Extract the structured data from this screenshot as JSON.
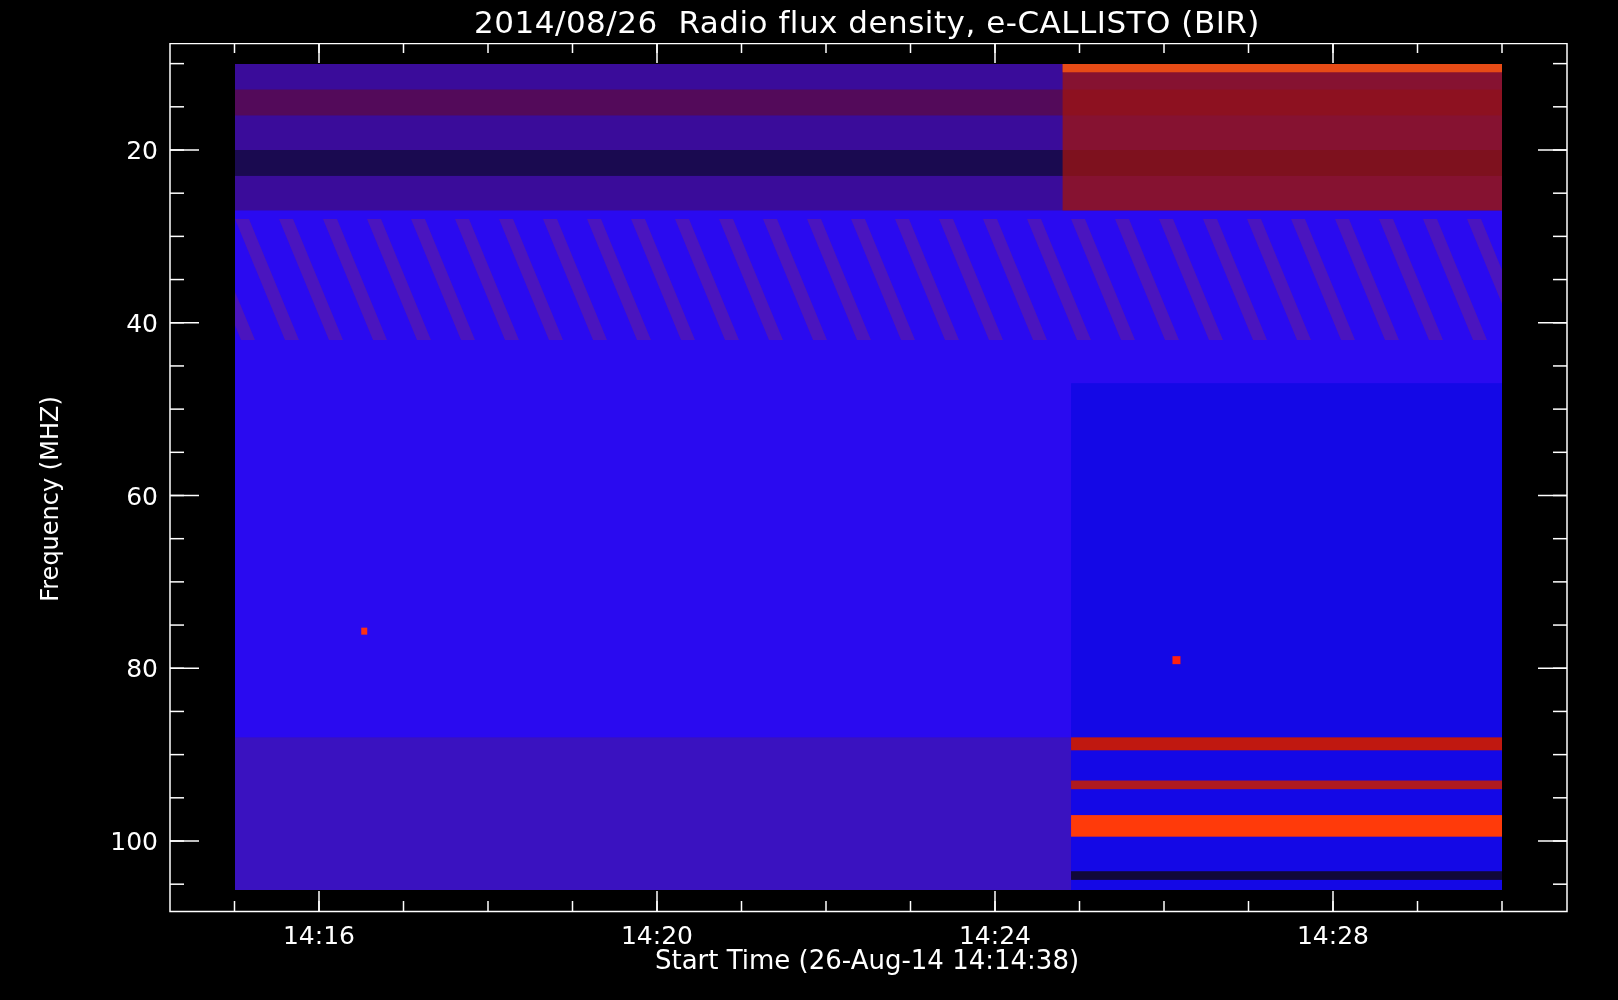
{
  "title": "2014/08/26  Radio flux density, e-CALLISTO (BIR)",
  "y_axis": {
    "label": "Frequency (MHZ)",
    "ticks": [
      "20",
      "40",
      "60",
      "80",
      "100"
    ]
  },
  "x_axis": {
    "label": "Start Time (26-Aug-14 14:14:38)",
    "ticks": [
      "14:16",
      "14:20",
      "14:24",
      "14:28"
    ]
  }
}
